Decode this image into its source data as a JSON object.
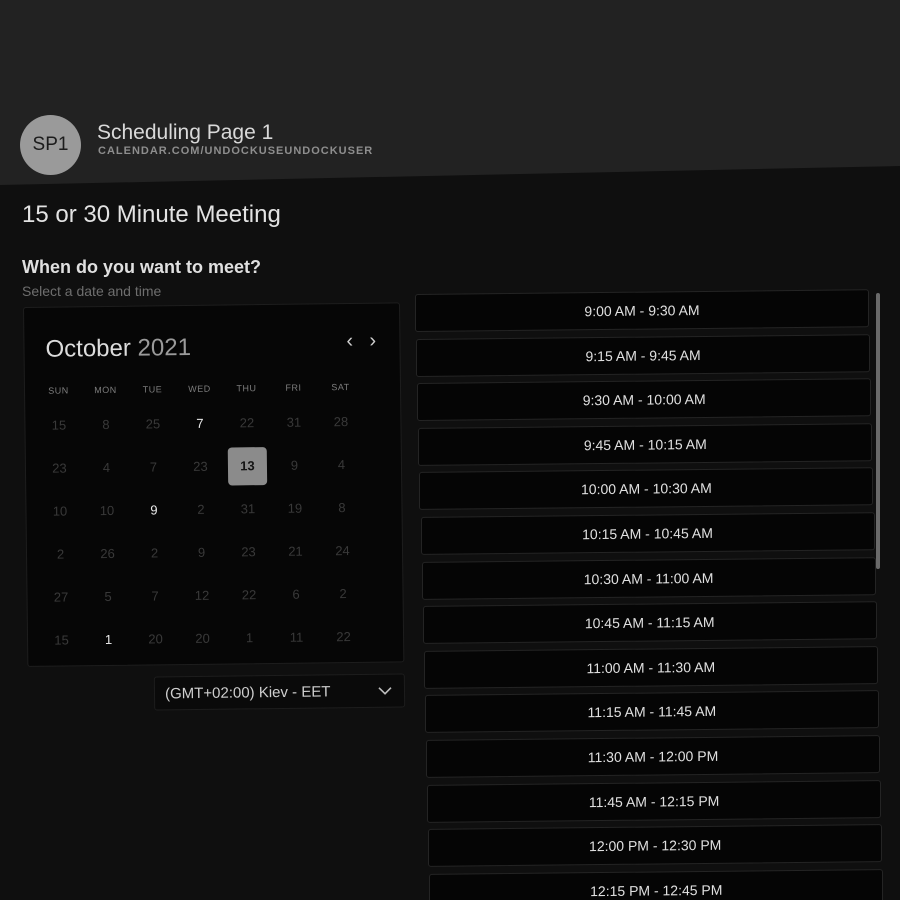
{
  "header": {
    "avatar_initials": "SP1",
    "page_title": "Scheduling Page 1",
    "page_url": "CALENDAR.COM/UNDOCKUSEUNDOCKUSER"
  },
  "meeting_title": "15 or 30 Minute Meeting",
  "question": "When do you want to meet?",
  "subtext": "Select a date and time",
  "calendar": {
    "month": "October",
    "year": "2021",
    "prev_icon": "‹",
    "next_icon": "›",
    "weekdays": [
      "SUN",
      "MON",
      "TUE",
      "WED",
      "THU",
      "FRI",
      "SAT"
    ],
    "weeks": [
      [
        {
          "d": "15",
          "s": "muted"
        },
        {
          "d": "8",
          "s": "muted"
        },
        {
          "d": "25",
          "s": "muted"
        },
        {
          "d": "7",
          "s": "active"
        },
        {
          "d": "22",
          "s": "muted"
        },
        {
          "d": "31",
          "s": "muted"
        },
        {
          "d": "28",
          "s": "muted"
        }
      ],
      [
        {
          "d": "23",
          "s": "muted"
        },
        {
          "d": "4",
          "s": "muted"
        },
        {
          "d": "7",
          "s": "muted"
        },
        {
          "d": "23",
          "s": "muted"
        },
        {
          "d": "13",
          "s": "selected"
        },
        {
          "d": "9",
          "s": "muted"
        },
        {
          "d": "4",
          "s": "muted"
        }
      ],
      [
        {
          "d": "10",
          "s": "muted"
        },
        {
          "d": "10",
          "s": "muted"
        },
        {
          "d": "9",
          "s": "active"
        },
        {
          "d": "2",
          "s": "muted"
        },
        {
          "d": "31",
          "s": "muted"
        },
        {
          "d": "19",
          "s": "muted"
        },
        {
          "d": "8",
          "s": "muted"
        }
      ],
      [
        {
          "d": "2",
          "s": "muted"
        },
        {
          "d": "26",
          "s": "muted"
        },
        {
          "d": "2",
          "s": "muted"
        },
        {
          "d": "9",
          "s": "muted"
        },
        {
          "d": "23",
          "s": "muted"
        },
        {
          "d": "21",
          "s": "muted"
        },
        {
          "d": "24",
          "s": "muted"
        }
      ],
      [
        {
          "d": "27",
          "s": "muted"
        },
        {
          "d": "5",
          "s": "muted"
        },
        {
          "d": "7",
          "s": "muted"
        },
        {
          "d": "12",
          "s": "muted"
        },
        {
          "d": "22",
          "s": "muted"
        },
        {
          "d": "6",
          "s": "muted"
        },
        {
          "d": "2",
          "s": "muted"
        }
      ],
      [
        {
          "d": "15",
          "s": "muted"
        },
        {
          "d": "1",
          "s": "active"
        },
        {
          "d": "20",
          "s": "muted"
        },
        {
          "d": "20",
          "s": "muted"
        },
        {
          "d": "1",
          "s": "muted"
        },
        {
          "d": "11",
          "s": "muted"
        },
        {
          "d": "22",
          "s": "muted"
        }
      ]
    ]
  },
  "timezone": {
    "value": "(GMT+02:00) Kiev - EET",
    "chevron_icon": "chevron-down-icon"
  },
  "time_slots": [
    "9:00 AM - 9:30 AM",
    "9:15 AM - 9:45 AM",
    "9:30 AM - 10:00 AM",
    "9:45 AM - 10:15 AM",
    "10:00 AM - 10:30 AM",
    "10:15 AM - 10:45 AM",
    "10:30 AM - 11:00 AM",
    "10:45 AM - 11:15 AM",
    "11:00 AM - 11:30 AM",
    "11:15 AM - 11:45 AM",
    "11:30 AM - 12:00 PM",
    "11:45 AM - 12:15 PM",
    "12:00 PM - 12:30 PM",
    "12:15 PM - 12:45 PM"
  ]
}
